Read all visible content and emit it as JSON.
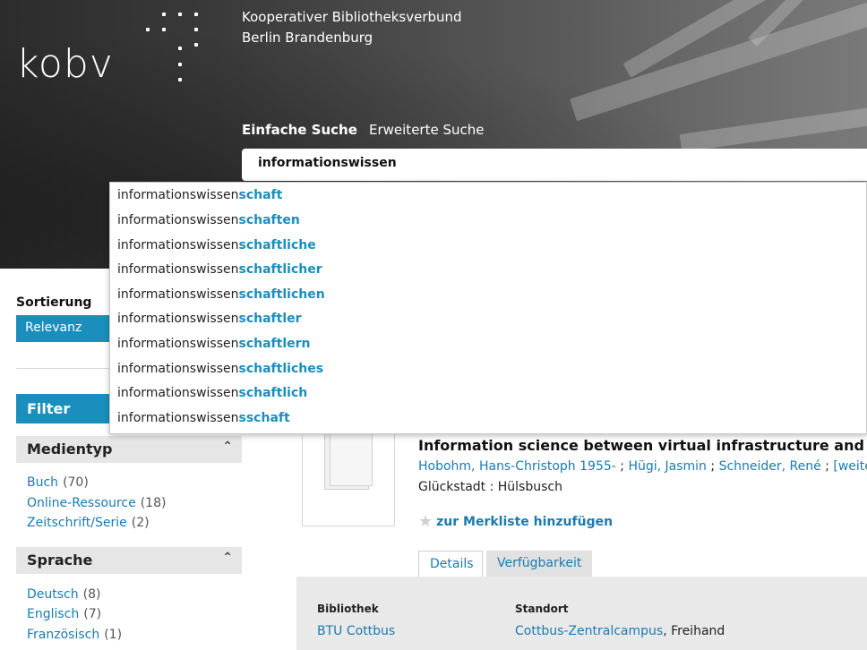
{
  "header": {
    "logo": "kobv",
    "org_line1": "Kooperativer Bibliotheksverbund",
    "org_line2": "Berlin Brandenburg",
    "tab_simple": "Einfache Suche",
    "tab_advanced": "Erweiterte Suche"
  },
  "search": {
    "value": "informationswissen"
  },
  "autocomplete": [
    {
      "prefix": "informationswissen",
      "suffix": "schaft"
    },
    {
      "prefix": "informationswissen",
      "suffix": "schaften"
    },
    {
      "prefix": "informationswissen",
      "suffix": "schaftliche"
    },
    {
      "prefix": "informationswissen",
      "suffix": "schaftlicher"
    },
    {
      "prefix": "informationswissen",
      "suffix": "schaftlichen"
    },
    {
      "prefix": "informationswissen",
      "suffix": "schaftler"
    },
    {
      "prefix": "informationswissen",
      "suffix": "schaftlern"
    },
    {
      "prefix": "informationswissen",
      "suffix": "schaftliches"
    },
    {
      "prefix": "informationswissen",
      "suffix": "schaftlich"
    },
    {
      "prefix": "informationswissen",
      "suffix": "sschaft"
    }
  ],
  "sidebar": {
    "sort_label": "Sortierung",
    "sort_value": "Relevanz",
    "filter_label": "Filter",
    "facets": [
      {
        "title": "Medientyp",
        "items": [
          {
            "label": "Buch",
            "count": "(70)"
          },
          {
            "label": "Online-Ressource",
            "count": "(18)"
          },
          {
            "label": "Zeitschrift/Serie",
            "count": "(2)"
          }
        ]
      },
      {
        "title": "Sprache",
        "items": [
          {
            "label": "Deutsch",
            "count": "(8)"
          },
          {
            "label": "Englisch",
            "count": "(7)"
          },
          {
            "label": "Französisch",
            "count": "(1)"
          }
        ]
      }
    ]
  },
  "result": {
    "title": "Information science between virtual infrastructure and mater",
    "authors": [
      {
        "name": "Hobohm, Hans-Christoph 1955-",
        "sep": " ; "
      },
      {
        "name": "Hügi, Jasmin",
        "sep": " ; "
      },
      {
        "name": "Schneider, René",
        "sep": " ; "
      },
      {
        "name": "[weitere",
        "sep": ""
      }
    ],
    "publisher": "Glückstadt : Hülsbusch",
    "merkliste": "zur Merkliste hinzufügen",
    "tabs": {
      "details": "Details",
      "availability": "Verfügbarkeit"
    },
    "availability": {
      "col_library": "Bibliothek",
      "col_location": "Standort",
      "library": "BTU Cottbus",
      "location_link": "Cottbus-Zentralcampus",
      "location_rest": ", Freihand"
    }
  },
  "colors": {
    "accent": "#1a8ebd",
    "link": "#1a7bb0"
  }
}
